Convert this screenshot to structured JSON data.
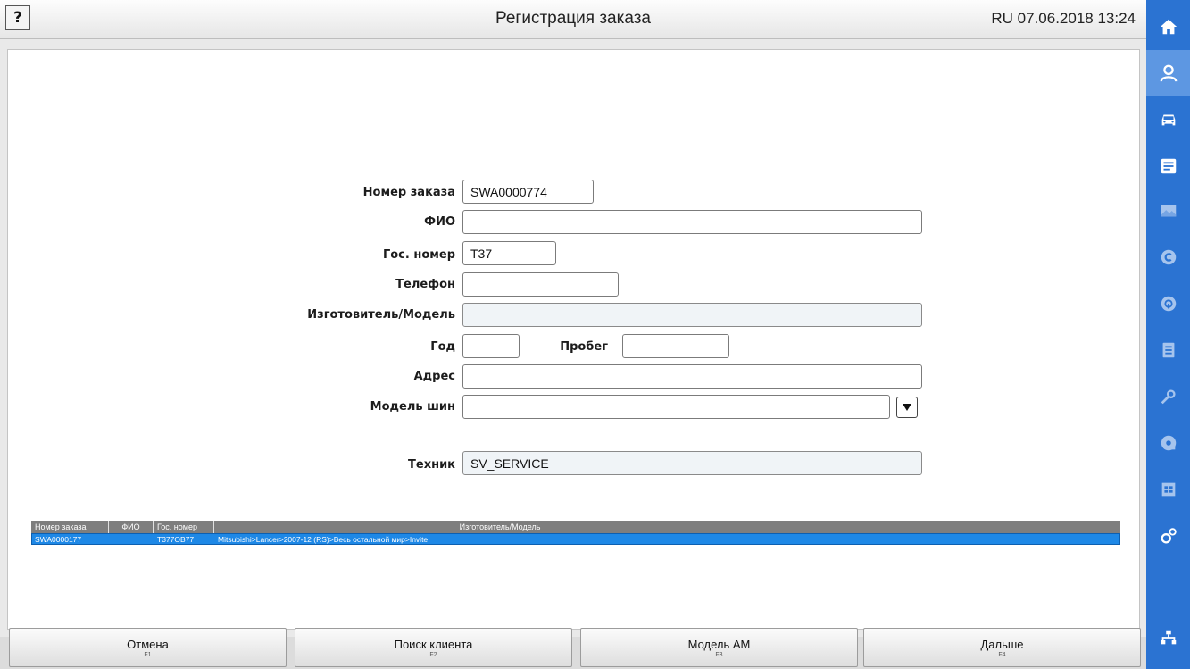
{
  "header": {
    "help_label": "?",
    "title": "Регистрация заказа",
    "datetime": "RU 07.06.2018 13:24"
  },
  "form": {
    "order_number": {
      "label": "Номер заказа",
      "value": "SWA0000774"
    },
    "full_name": {
      "label": "ФИО",
      "value": ""
    },
    "plate": {
      "label": "Гос. номер",
      "value": "T37"
    },
    "phone": {
      "label": "Телефон",
      "value": ""
    },
    "make_model": {
      "label": "Изготовитель/Модель",
      "value": ""
    },
    "year": {
      "label": "Год",
      "value": ""
    },
    "mileage": {
      "label": "Пробег",
      "value": ""
    },
    "address": {
      "label": "Адрес",
      "value": ""
    },
    "tire_model": {
      "label": "Модель шин",
      "value": ""
    },
    "technician": {
      "label": "Техник",
      "value": "SV_SERVICE"
    }
  },
  "table": {
    "columns": [
      "Номер заказа",
      "ФИО",
      "Гос. номер",
      "Изготовитель/Модель",
      ""
    ],
    "rows": [
      {
        "order": "SWA0000177",
        "name": "",
        "plate": "T377OB77",
        "model": "Mitsubishi>Lancer>2007-12 (RS)>Весь остальной мир>Invite",
        "extra": ""
      }
    ]
  },
  "buttons": [
    {
      "label": "Отмена",
      "key": "F1"
    },
    {
      "label": "Поиск клиента",
      "key": "F2"
    },
    {
      "label": "Модель АМ",
      "key": "F3"
    },
    {
      "label": "Дальше",
      "key": "F4"
    }
  ],
  "nav_icons": [
    "home-icon",
    "customer-icon",
    "car-icon",
    "document-icon",
    "image-icon",
    "c-circle-icon",
    "tire-icon",
    "checklist-icon",
    "wrench-icon",
    "service-icon",
    "report-icon",
    "settings-icon",
    "network-icon"
  ],
  "colors": {
    "accent": "#2b73d2",
    "selected_row": "#1e88e6",
    "header_gray": "#7e7e7e"
  }
}
